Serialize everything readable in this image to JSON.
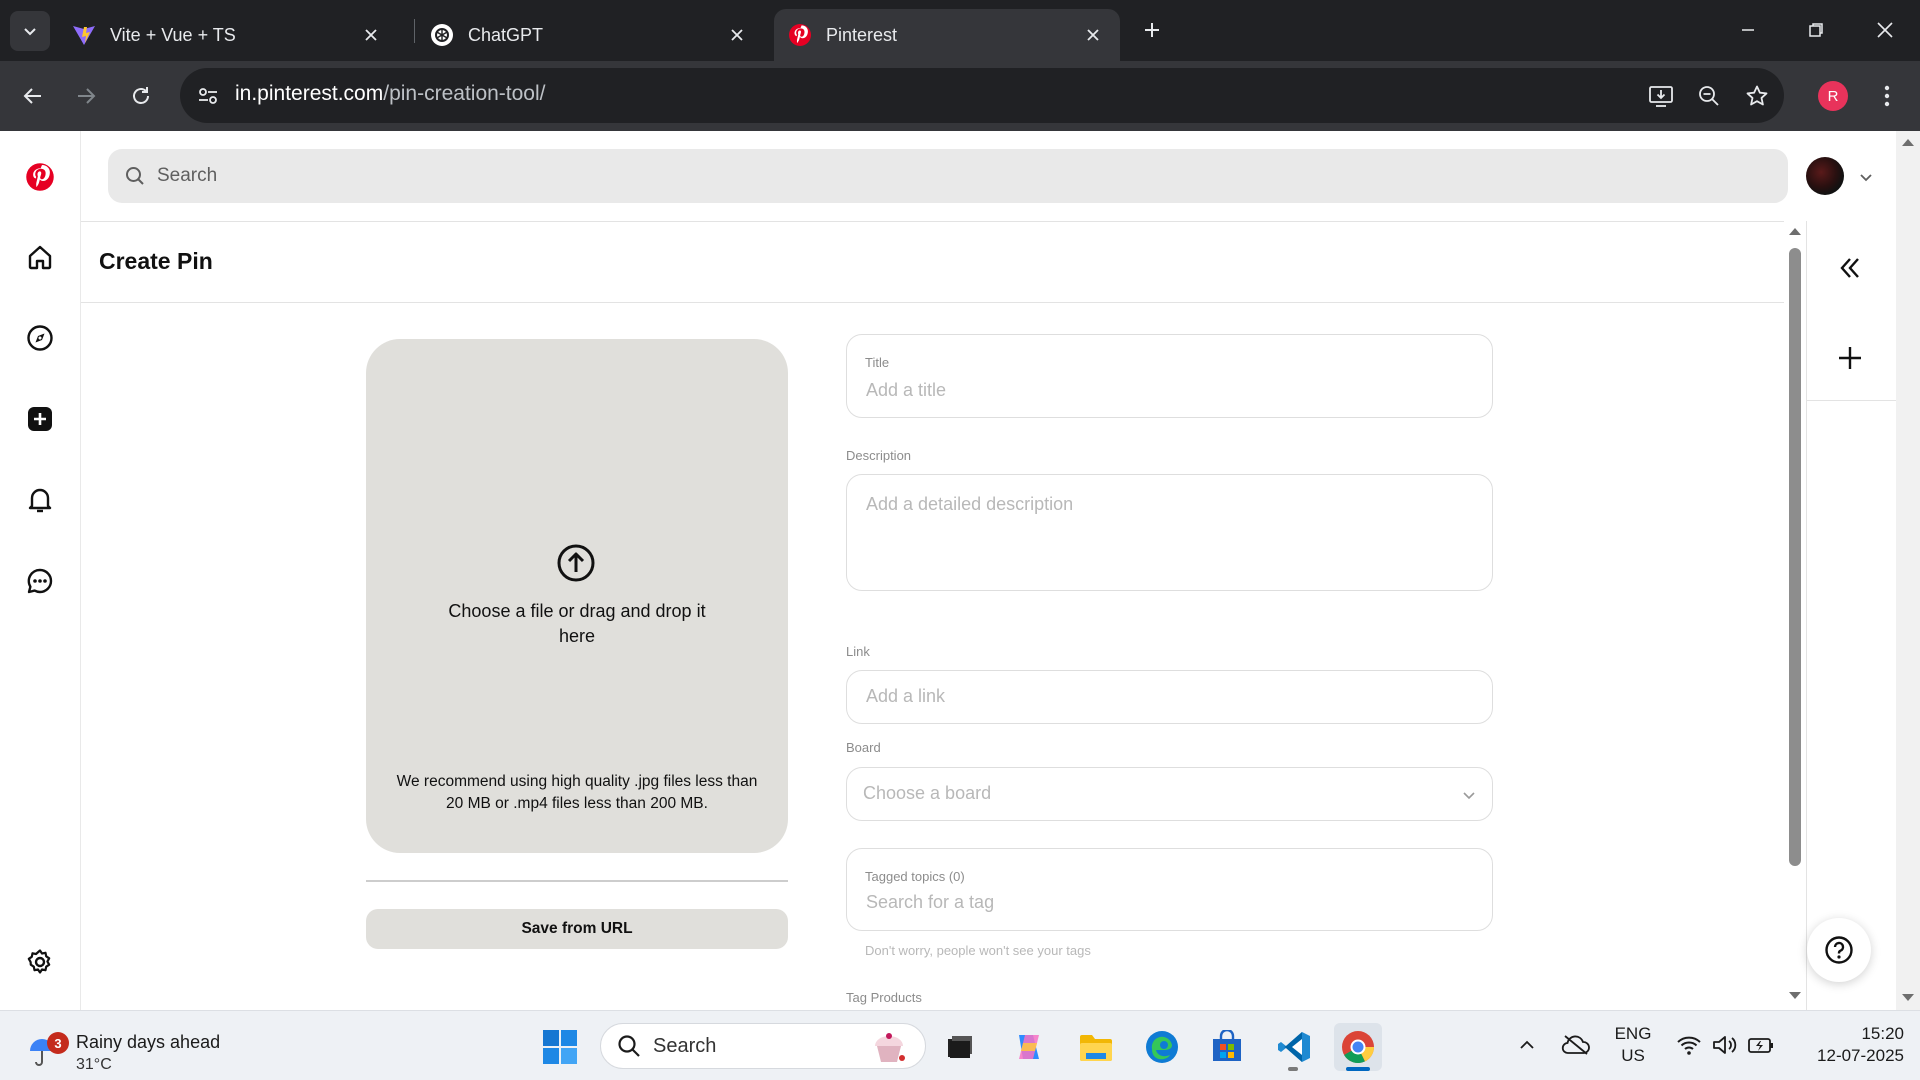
{
  "browser": {
    "tabs": [
      {
        "title": "Vite + Vue + TS",
        "favicon": "vite-icon"
      },
      {
        "title": "ChatGPT",
        "favicon": "chatgpt-icon"
      },
      {
        "title": "Pinterest",
        "favicon": "pinterest-icon",
        "active": true
      }
    ],
    "url_host": "in.pinterest.com",
    "url_path": "/pin-creation-tool/",
    "profile_initial": "R",
    "profile_color": "#e8335b"
  },
  "pinterest": {
    "brand_color": "#e60023",
    "search_placeholder": "Search",
    "page_title": "Create Pin",
    "upload": {
      "prompt": "Choose a file or drag and drop it here",
      "recommendation": "We recommend using high quality .jpg files less than 20 MB or .mp4 files less than 200 MB."
    },
    "save_from_url": "Save from URL",
    "form": {
      "title_label": "Title",
      "title_placeholder": "Add a title",
      "description_label": "Description",
      "description_placeholder": "Add a detailed description",
      "link_label": "Link",
      "link_placeholder": "Add a link",
      "board_label": "Board",
      "board_placeholder": "Choose a board",
      "tagged_topics_label": "Tagged topics (0)",
      "tagged_topics_placeholder": "Search for a tag",
      "tag_hint": "Don't worry, people won't see your tags",
      "tag_products_label": "Tag Products"
    }
  },
  "taskbar": {
    "weather_badge": "3",
    "weather_title": "Rainy days ahead",
    "weather_temp": "31°C",
    "search_label": "Search",
    "lang_line1": "ENG",
    "lang_line2": "US",
    "time": "15:20",
    "date": "12-07-2025"
  }
}
